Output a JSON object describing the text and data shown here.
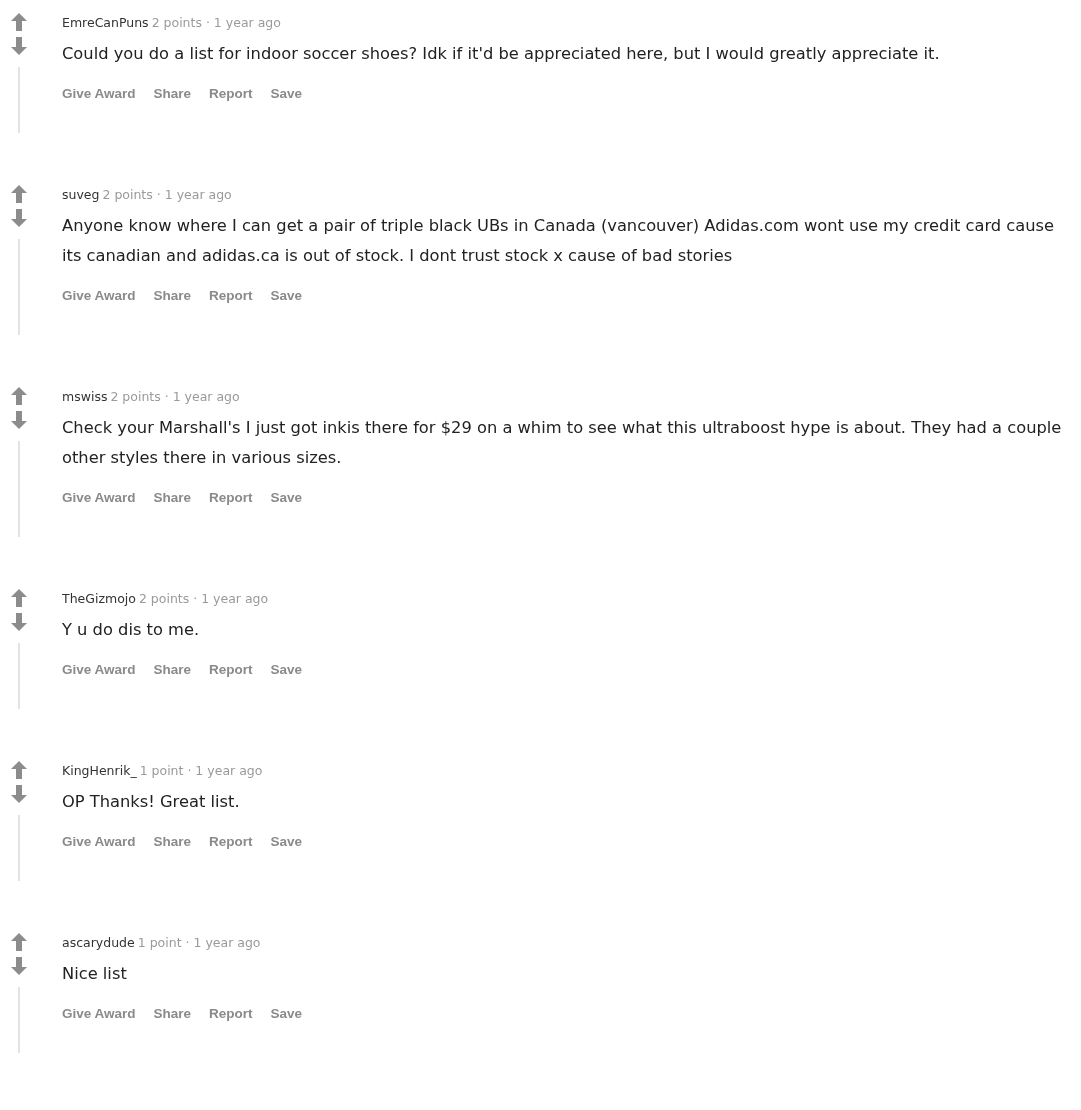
{
  "comments": [
    {
      "author": "EmreCanPuns",
      "meta": "2 points · 1 year ago",
      "body": "Could you do a list for indoor soccer shoes? Idk if it'd be appreciated here, but I would greatly appreciate it.",
      "actions": [
        "Give Award",
        "Share",
        "Report",
        "Save"
      ]
    },
    {
      "author": "suveg",
      "meta": "2 points · 1 year ago",
      "body": "Anyone know where I can get a pair of triple black UBs in Canada (vancouver) Adidas.com wont use my credit card cause its canadian and adidas.ca is out of stock. I dont trust stock x cause of bad stories",
      "actions": [
        "Give Award",
        "Share",
        "Report",
        "Save"
      ]
    },
    {
      "author": "mswiss",
      "meta": "2 points · 1 year ago",
      "body": "Check your Marshall's I just got inkis there for $29 on a whim to see what this ultraboost hype is about. They had a couple other styles there in various sizes.",
      "actions": [
        "Give Award",
        "Share",
        "Report",
        "Save"
      ]
    },
    {
      "author": "TheGizmojo",
      "meta": "2 points · 1 year ago",
      "body": "Y u do dis to me.",
      "actions": [
        "Give Award",
        "Share",
        "Report",
        "Save"
      ]
    },
    {
      "author": "KingHenrik_",
      "meta": "1 point · 1 year ago",
      "body": "OP Thanks! Great list.",
      "actions": [
        "Give Award",
        "Share",
        "Report",
        "Save"
      ]
    },
    {
      "author": "ascarydude",
      "meta": "1 point · 1 year ago",
      "body": "Nice list",
      "actions": [
        "Give Award",
        "Share",
        "Report",
        "Save"
      ]
    }
  ]
}
